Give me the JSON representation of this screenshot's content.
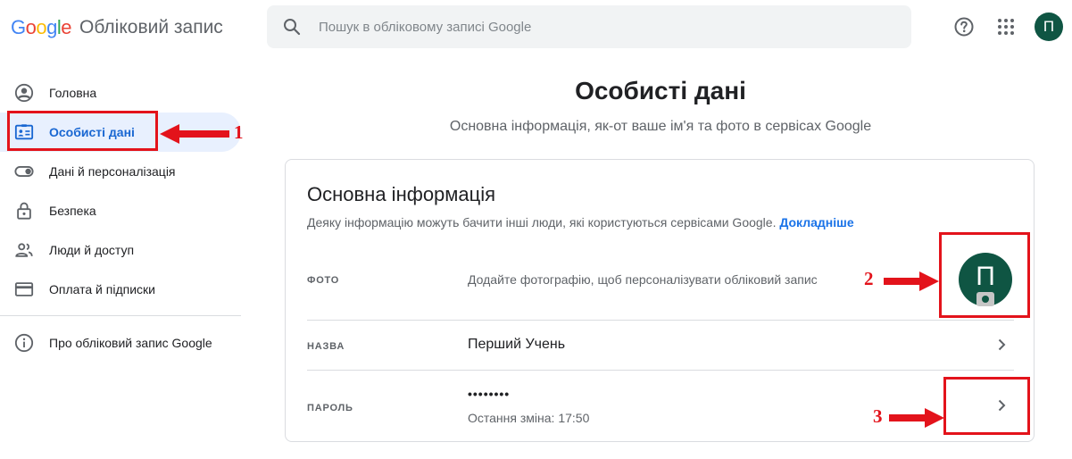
{
  "header": {
    "logo_letters": [
      "G",
      "o",
      "o",
      "g",
      "l",
      "e"
    ],
    "product_name": "Обліковий запис",
    "search_placeholder": "Пошук в обліковому записі Google",
    "help_icon": "help-icon",
    "apps_icon": "apps-grid-icon",
    "avatar_letter": "П",
    "avatar_color": "#0f5543"
  },
  "sidebar": {
    "items": [
      {
        "label": "Головна",
        "icon": "account-circle-icon"
      },
      {
        "label": "Особисті дані",
        "icon": "id-card-icon",
        "active": true
      },
      {
        "label": "Дані й персоналізація",
        "icon": "toggle-icon"
      },
      {
        "label": "Безпека",
        "icon": "lock-icon"
      },
      {
        "label": "Люди й доступ",
        "icon": "people-icon"
      },
      {
        "label": "Оплата й підписки",
        "icon": "credit-card-icon"
      }
    ],
    "about": {
      "label": "Про обліковий запис Google",
      "icon": "info-icon"
    }
  },
  "main": {
    "title": "Особисті дані",
    "subtitle": "Основна інформація, як-от ваше ім'я та фото в сервісах Google",
    "card": {
      "title": "Основна інформація",
      "description": "Деяку інформацію можуть бачити інші люди, які користуються сервісами Google.",
      "learn_more": "Докладніше",
      "rows": {
        "photo": {
          "label": "ФОТО",
          "value": "Додайте фотографію, щоб персоналізувати обліковий запис",
          "avatar_letter": "П"
        },
        "name": {
          "label": "НАЗВА",
          "value": "Перший Учень"
        },
        "password": {
          "label": "ПАРОЛЬ",
          "value": "••••••••",
          "last_changed": "Остання зміна: 17:50"
        }
      }
    }
  },
  "annotations": {
    "color": "#e3131b",
    "labels": [
      "1",
      "2",
      "3"
    ]
  },
  "colors": {
    "accent_blue": "#1a73e8",
    "active_bg": "#e8f0fe",
    "active_text": "#1967d2"
  }
}
